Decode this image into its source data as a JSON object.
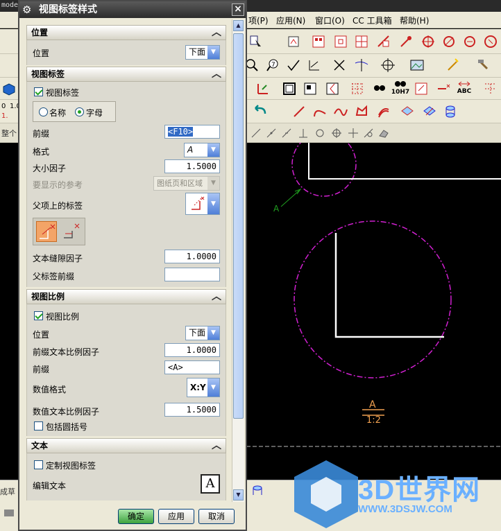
{
  "app": {
    "topbar_fragment": "mode",
    "menu": [
      {
        "label": "项(P)"
      },
      {
        "label": "应用(N)"
      },
      {
        "label": "窗口(O)"
      },
      {
        "label": "CC 工具箱"
      },
      {
        "label": "帮助(H)"
      }
    ],
    "left_fragments": {
      "num1": "0",
      "num2": "1.0",
      "num3": "1.",
      "whole": "整个",
      "pipe": "成草"
    },
    "toolbar_texts": {
      "h7": "10H7",
      "abc": "ABC"
    }
  },
  "dialog": {
    "title": "视图标签样式",
    "close": "×",
    "sections": {
      "position": {
        "header": "位置",
        "position_label": "位置",
        "position_value": "下面"
      },
      "view_label": {
        "header": "视图标签",
        "checkbox_label": "视图标签",
        "checkbox_checked": true,
        "radio_name": "名称",
        "radio_letter": "字母",
        "radio_selected": "字母",
        "prefix_label": "前缀",
        "prefix_value": "<F10>",
        "format_label": "格式",
        "format_value": "A",
        "size_factor_label": "大小因子",
        "size_factor_value": "1.5000",
        "ref_label": "要显示的参考",
        "ref_value": "图纸页和区域",
        "parent_label_label": "父项上的标签",
        "text_gap_label": "文本缝隙因子",
        "text_gap_value": "1.0000",
        "parent_prefix_label": "父标签前缀",
        "parent_prefix_value": ""
      },
      "view_scale": {
        "header": "视图比例",
        "checkbox_label": "视图比例",
        "checkbox_checked": true,
        "position_label": "位置",
        "position_value": "下面",
        "prefix_scale_label": "前缀文本比例因子",
        "prefix_scale_value": "1.0000",
        "prefix_label": "前缀",
        "prefix_value": "<A>",
        "num_format_label": "数值格式",
        "num_format_value": "X:Y",
        "num_scale_label": "数值文本比例因子",
        "num_scale_value": "1.5000",
        "parens_label": "包括圆括号",
        "parens_checked": false
      },
      "text": {
        "header": "文本",
        "custom_label": "定制视图标签",
        "custom_checked": false,
        "edit_text_label": "编辑文本",
        "edit_text_icon": "A"
      }
    },
    "buttons": {
      "ok": "确定",
      "apply": "应用",
      "cancel": "取消"
    }
  },
  "drawing": {
    "label_a": "A",
    "section_letter": "A",
    "section_scale": "1:2"
  },
  "watermark": {
    "brand": "3D世界网",
    "url": "WWW.3DSJW.COM"
  },
  "colors": {
    "magenta": "#d020d0",
    "orange": "#f0a050",
    "green": "#20a020",
    "panel": "#ece9d8",
    "header": "#3a3a3a"
  }
}
